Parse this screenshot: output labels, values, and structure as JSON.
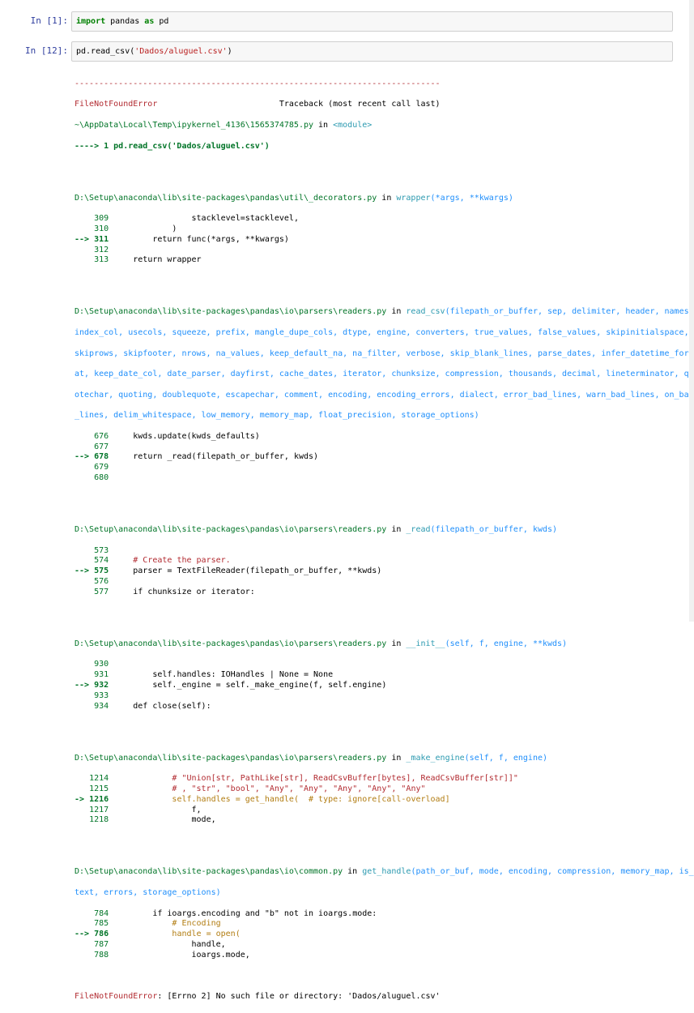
{
  "cells": [
    {
      "prompt": "In [1]:",
      "code_kw1": "import",
      "code_mid": " pandas ",
      "code_kw2": "as",
      "code_end": " pd"
    },
    {
      "prompt": "In [12]:",
      "code_pre": "pd.read_csv(",
      "code_str": "'Dados/aluguel.csv'",
      "code_post": ")"
    }
  ],
  "traceback": {
    "separator": "---------------------------------------------------------------------------",
    "error_name": "FileNotFoundError",
    "traceback_label": "                         Traceback (most recent call last)",
    "file0": "~\\AppData\\Local\\Temp\\ipykernel_4136\\1565374785.py",
    "file0_in": " in ",
    "file0_mod": "<module>",
    "arrow0": "----> 1 pd.read_csv('Dados/aluguel.csv')",
    "frames": [
      {
        "path": "D:\\Setup\\anaconda\\lib\\site-packages\\pandas\\util\\_decorators.py",
        "in": " in ",
        "func": "wrapper",
        "sig": "(*args, **kwargs)",
        "lines": [
          {
            "marker": "    ",
            "num": "309",
            "code": "                stacklevel=stacklevel,"
          },
          {
            "marker": "    ",
            "num": "310",
            "code": "            )"
          },
          {
            "marker": "--> ",
            "num": "311",
            "code": "        return func(*args, **kwargs)"
          },
          {
            "marker": "    ",
            "num": "312",
            "code": ""
          },
          {
            "marker": "    ",
            "num": "313",
            "code": "    return wrapper"
          }
        ]
      }
    ],
    "frame2_path": "D:\\Setup\\anaconda\\lib\\site-packages\\pandas\\io\\parsers\\readers.py",
    "frame2_in": " in ",
    "frame2_func": "read_csv",
    "frame2_sig_lines": [
      "(filepath_or_buffer, sep, delimiter, header, names,",
      "index_col, usecols, squeeze, prefix, mangle_dupe_cols, dtype, engine, converters, true_values, false_values, skipinitialspace,",
      "skiprows, skipfooter, nrows, na_values, keep_default_na, na_filter, verbose, skip_blank_lines, parse_dates, infer_datetime_form",
      "at, keep_date_col, date_parser, dayfirst, cache_dates, iterator, chunksize, compression, thousands, decimal, lineterminator, qu",
      "otechar, quoting, doublequote, escapechar, comment, encoding, encoding_errors, dialect, error_bad_lines, warn_bad_lines, on_bad",
      "_lines, delim_whitespace, low_memory, memory_map, float_precision, storage_options)"
    ],
    "frame2_lines": [
      {
        "marker": "    ",
        "num": "676",
        "code": "    kwds.update(kwds_defaults)"
      },
      {
        "marker": "    ",
        "num": "677",
        "code": ""
      },
      {
        "marker": "--> ",
        "num": "678",
        "code": "    return _read(filepath_or_buffer, kwds)"
      },
      {
        "marker": "    ",
        "num": "679",
        "code": ""
      },
      {
        "marker": "    ",
        "num": "680",
        "code": ""
      }
    ],
    "frame3_path": "D:\\Setup\\anaconda\\lib\\site-packages\\pandas\\io\\parsers\\readers.py",
    "frame3_in": " in ",
    "frame3_func": "_read",
    "frame3_sig": "(filepath_or_buffer, kwds)",
    "frame3_lines": [
      {
        "marker": "    ",
        "num": "573",
        "code": ""
      },
      {
        "marker": "    ",
        "num": "574",
        "code": "    # Create the parser."
      },
      {
        "marker": "--> ",
        "num": "575",
        "code": "    parser = TextFileReader(filepath_or_buffer, **kwds)"
      },
      {
        "marker": "    ",
        "num": "576",
        "code": ""
      },
      {
        "marker": "    ",
        "num": "577",
        "code": "    if chunksize or iterator:"
      }
    ],
    "frame4_path": "D:\\Setup\\anaconda\\lib\\site-packages\\pandas\\io\\parsers\\readers.py",
    "frame4_in": " in ",
    "frame4_func": "__init__",
    "frame4_sig": "(self, f, engine, **kwds)",
    "frame4_lines": [
      {
        "marker": "    ",
        "num": "930",
        "code": ""
      },
      {
        "marker": "    ",
        "num": "931",
        "code": "        self.handles: IOHandles | None = None"
      },
      {
        "marker": "--> ",
        "num": "932",
        "code": "        self._engine = self._make_engine(f, self.engine)"
      },
      {
        "marker": "    ",
        "num": "933",
        "code": ""
      },
      {
        "marker": "    ",
        "num": "934",
        "code": "    def close(self):"
      }
    ],
    "frame5_path": "D:\\Setup\\anaconda\\lib\\site-packages\\pandas\\io\\parsers\\readers.py",
    "frame5_in": " in ",
    "frame5_func": "_make_engine",
    "frame5_sig": "(self, f, engine)",
    "frame5_lines": [
      {
        "marker": "   ",
        "num": "1214",
        "code": "            # \"Union[str, PathLike[str], ReadCsvBuffer[bytes], ReadCsvBuffer[str]]\""
      },
      {
        "marker": "   ",
        "num": "1215",
        "code": "            # , \"str\", \"bool\", \"Any\", \"Any\", \"Any\", \"Any\", \"Any\""
      },
      {
        "marker": "-> ",
        "num": "1216",
        "code": "            self.handles = get_handle(  # type: ignore[call-overload]"
      },
      {
        "marker": "   ",
        "num": "1217",
        "code": "                f,"
      },
      {
        "marker": "   ",
        "num": "1218",
        "code": "                mode,"
      }
    ],
    "frame6_path": "D:\\Setup\\anaconda\\lib\\site-packages\\pandas\\io\\common.py",
    "frame6_in": " in ",
    "frame6_func": "get_handle",
    "frame6_sig_lines": [
      "(path_or_buf, mode, encoding, compression, memory_map, is_",
      "text, errors, storage_options)"
    ],
    "frame6_lines": [
      {
        "marker": "    ",
        "num": "784",
        "code": "        if ioargs.encoding and \"b\" not in ioargs.mode:"
      },
      {
        "marker": "    ",
        "num": "785",
        "code": "            # Encoding"
      },
      {
        "marker": "--> ",
        "num": "786",
        "code": "            handle = open("
      },
      {
        "marker": "    ",
        "num": "787",
        "code": "                handle,"
      },
      {
        "marker": "    ",
        "num": "788",
        "code": "                ioargs.mode,"
      }
    ],
    "final_error": "FileNotFoundError",
    "final_msg": ": [Errno 2] No such file or directory: 'Dados/aluguel.csv'"
  }
}
